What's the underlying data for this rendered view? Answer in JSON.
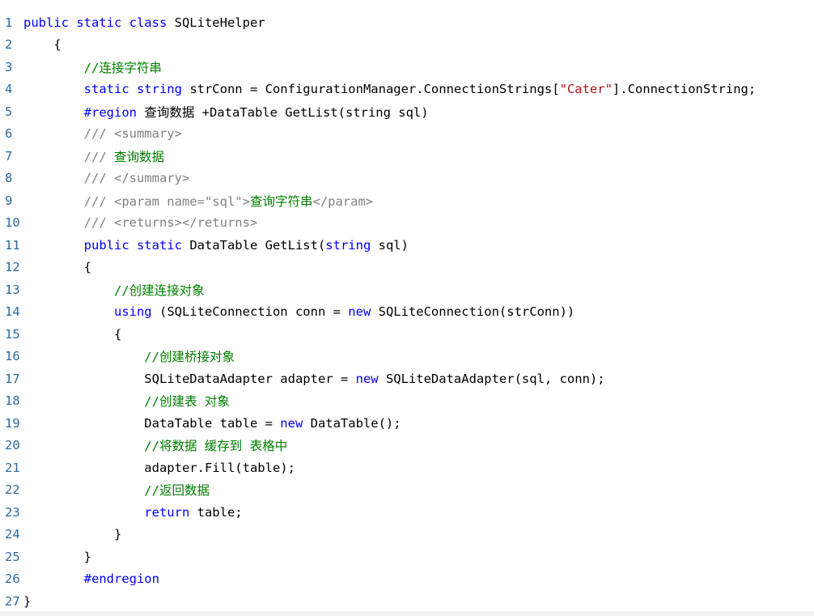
{
  "colors": {
    "line_number": "#2d6a9f",
    "keyword": "#0000ff",
    "comment": "#008000",
    "string": "#a31515",
    "xml_doc": "#808080",
    "plain": "#000000",
    "background": "#ffffff"
  },
  "lines": [
    {
      "n": "1",
      "tokens": [
        {
          "t": "kw",
          "v": "public static class "
        },
        {
          "t": "plain",
          "v": "SQLiteHelper"
        }
      ]
    },
    {
      "n": "2",
      "tokens": [
        {
          "t": "plain",
          "v": "    {"
        }
      ]
    },
    {
      "n": "3",
      "tokens": [
        {
          "t": "cm",
          "v": "        //连接字符串"
        }
      ]
    },
    {
      "n": "4",
      "tokens": [
        {
          "t": "kw",
          "v": "        static string "
        },
        {
          "t": "plain",
          "v": "strConn = ConfigurationManager.ConnectionStrings["
        },
        {
          "t": "str",
          "v": "\"Cater\""
        },
        {
          "t": "plain",
          "v": "].ConnectionString;"
        }
      ]
    },
    {
      "n": "5",
      "tokens": [
        {
          "t": "kw",
          "v": "        #region "
        },
        {
          "t": "plain",
          "v": "查询数据 +DataTable GetList(string sql)"
        }
      ]
    },
    {
      "n": "6",
      "tokens": [
        {
          "t": "xml",
          "v": "        /// <summary>"
        }
      ]
    },
    {
      "n": "7",
      "tokens": [
        {
          "t": "xml",
          "v": "        /// "
        },
        {
          "t": "cm",
          "v": "查询数据"
        }
      ]
    },
    {
      "n": "8",
      "tokens": [
        {
          "t": "xml",
          "v": "        /// </summary>"
        }
      ]
    },
    {
      "n": "9",
      "tokens": [
        {
          "t": "xml",
          "v": "        /// <param name=\"sql\">"
        },
        {
          "t": "cm",
          "v": "查询字符串"
        },
        {
          "t": "xml",
          "v": "</param>"
        }
      ]
    },
    {
      "n": "10",
      "tokens": [
        {
          "t": "xml",
          "v": "        /// <returns></returns>"
        }
      ]
    },
    {
      "n": "11",
      "tokens": [
        {
          "t": "kw",
          "v": "        public static "
        },
        {
          "t": "plain",
          "v": "DataTable GetList("
        },
        {
          "t": "kw",
          "v": "string "
        },
        {
          "t": "plain",
          "v": "sql)"
        }
      ]
    },
    {
      "n": "12",
      "tokens": [
        {
          "t": "plain",
          "v": "        {"
        }
      ]
    },
    {
      "n": "13",
      "tokens": [
        {
          "t": "cm",
          "v": "            //创建连接对象"
        }
      ]
    },
    {
      "n": "14",
      "tokens": [
        {
          "t": "kw",
          "v": "            using "
        },
        {
          "t": "plain",
          "v": "(SQLiteConnection conn = "
        },
        {
          "t": "kw",
          "v": "new "
        },
        {
          "t": "plain",
          "v": "SQLiteConnection(strConn))"
        }
      ]
    },
    {
      "n": "15",
      "tokens": [
        {
          "t": "plain",
          "v": "            {"
        }
      ]
    },
    {
      "n": "16",
      "tokens": [
        {
          "t": "cm",
          "v": "                //创建桥接对象"
        }
      ]
    },
    {
      "n": "17",
      "tokens": [
        {
          "t": "plain",
          "v": "                SQLiteDataAdapter adapter = "
        },
        {
          "t": "kw",
          "v": "new "
        },
        {
          "t": "plain",
          "v": "SQLiteDataAdapter(sql, conn);"
        }
      ]
    },
    {
      "n": "18",
      "tokens": [
        {
          "t": "cm",
          "v": "                //创建表 对象"
        }
      ]
    },
    {
      "n": "19",
      "tokens": [
        {
          "t": "plain",
          "v": "                DataTable table = "
        },
        {
          "t": "kw",
          "v": "new "
        },
        {
          "t": "plain",
          "v": "DataTable();"
        }
      ]
    },
    {
      "n": "20",
      "tokens": [
        {
          "t": "cm",
          "v": "                //将数据 缓存到 表格中"
        }
      ]
    },
    {
      "n": "21",
      "tokens": [
        {
          "t": "plain",
          "v": "                adapter.Fill(table);"
        }
      ]
    },
    {
      "n": "22",
      "tokens": [
        {
          "t": "cm",
          "v": "                //返回数据"
        }
      ]
    },
    {
      "n": "23",
      "tokens": [
        {
          "t": "kw",
          "v": "                return "
        },
        {
          "t": "plain",
          "v": "table;"
        }
      ]
    },
    {
      "n": "24",
      "tokens": [
        {
          "t": "plain",
          "v": "            }"
        }
      ]
    },
    {
      "n": "25",
      "tokens": [
        {
          "t": "plain",
          "v": "        }"
        }
      ]
    },
    {
      "n": "26",
      "tokens": [
        {
          "t": "kw",
          "v": "        #endregion"
        }
      ]
    },
    {
      "n": "27",
      "tokens": [
        {
          "t": "plain",
          "v": "}"
        }
      ]
    }
  ]
}
